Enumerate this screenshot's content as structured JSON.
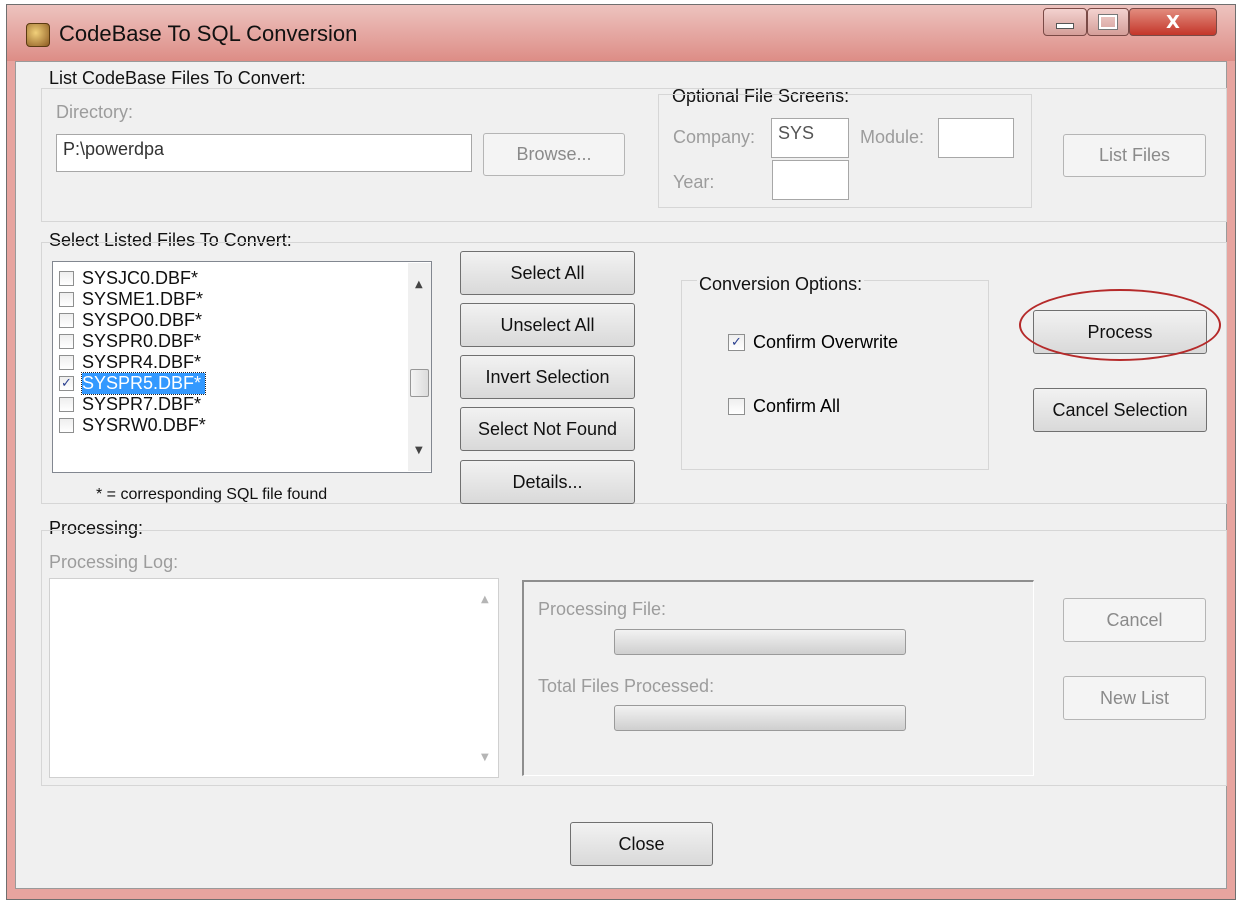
{
  "window": {
    "title": "CodeBase To SQL Conversion",
    "close_glyph": "X"
  },
  "list_group": {
    "label": "List CodeBase Files To Convert:",
    "directory_label": "Directory:",
    "directory_value": "P:\\powerdpa",
    "browse_label": "Browse...",
    "screens_label": "Optional File Screens:",
    "company_label": "Company:",
    "company_value": "SYS",
    "module_label": "Module:",
    "module_value": "",
    "year_label": "Year:",
    "year_value": "",
    "list_files_label": "List Files"
  },
  "select_group": {
    "label": "Select Listed Files To Convert:",
    "files": [
      {
        "name": "SYSJC0.DBF*",
        "checked": false,
        "selected": false
      },
      {
        "name": "SYSME1.DBF*",
        "checked": false,
        "selected": false
      },
      {
        "name": "SYSPO0.DBF*",
        "checked": false,
        "selected": false
      },
      {
        "name": "SYSPR0.DBF*",
        "checked": false,
        "selected": false
      },
      {
        "name": "SYSPR4.DBF*",
        "checked": false,
        "selected": false
      },
      {
        "name": "SYSPR5.DBF*",
        "checked": true,
        "selected": true
      },
      {
        "name": "SYSPR7.DBF*",
        "checked": false,
        "selected": false
      },
      {
        "name": "SYSRW0.DBF*",
        "checked": false,
        "selected": false
      }
    ],
    "legend": "* = corresponding SQL file found",
    "select_all": "Select All",
    "unselect_all": "Unselect All",
    "invert_selection": "Invert Selection",
    "select_not_found": "Select Not Found",
    "details": "Details...",
    "conversion_options_label": "Conversion Options:",
    "confirm_overwrite_label": "Confirm Overwrite",
    "confirm_overwrite_checked": true,
    "confirm_all_label": "Confirm All",
    "confirm_all_checked": false,
    "process_label": "Process",
    "cancel_selection_label": "Cancel Selection"
  },
  "processing_group": {
    "label": "Processing:",
    "log_label": "Processing Log:",
    "processing_file_label": "Processing File:",
    "processing_file_progress": 0,
    "total_files_label": "Total Files Processed:",
    "total_files_progress": 0,
    "cancel_label": "Cancel",
    "new_list_label": "New List"
  },
  "footer": {
    "close_label": "Close"
  },
  "icons": {
    "up_arrow": "▲",
    "down_arrow": "▼",
    "check": "✓"
  },
  "colors": {
    "title_bar": "#dd8d86",
    "selection": "#3399ff",
    "annotation_circle": "#b52a2a"
  }
}
